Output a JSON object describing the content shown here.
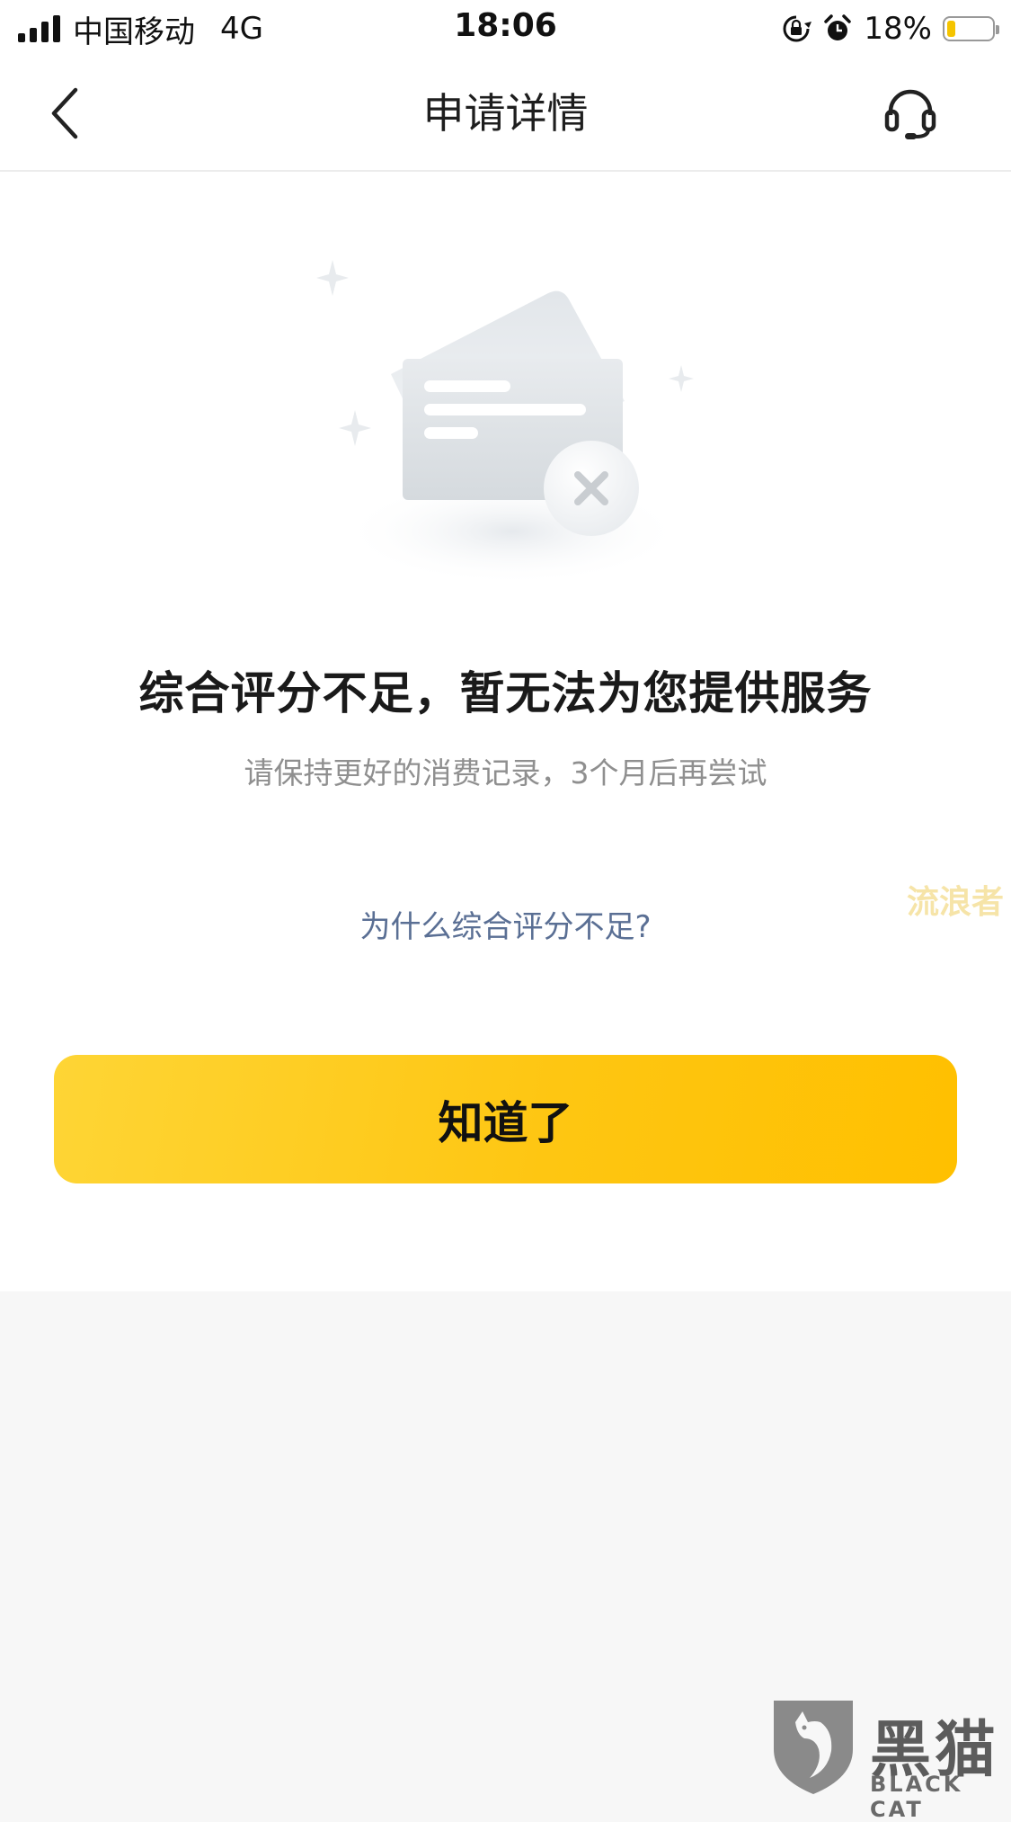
{
  "status_bar": {
    "carrier": "中国移动",
    "network": "4G",
    "time": "18:06",
    "battery_percent": "18%",
    "battery_level": 0.18,
    "icons": [
      "signal-icon",
      "rotation-lock-icon",
      "alarm-icon",
      "battery-icon"
    ]
  },
  "nav": {
    "title": "申请详情",
    "back_icon": "chevron-left-icon",
    "service_icon": "headset-icon"
  },
  "result": {
    "illustration": "rejected-card-icon",
    "title": "综合评分不足，暂无法为您提供服务",
    "subtitle": "请保持更好的消费记录，3个月后再尝试",
    "why_link": "为什么综合评分不足?",
    "watermark": "流浪者"
  },
  "actions": {
    "confirm_label": "知道了"
  },
  "footer_watermark": {
    "name": "黑猫",
    "subtitle": "BLACK CAT"
  },
  "colors": {
    "accent_yellow": "#fec612",
    "link_blue": "#5a6f94",
    "subtitle_gray": "#8f8f8f",
    "background": "#f7f7f7"
  }
}
